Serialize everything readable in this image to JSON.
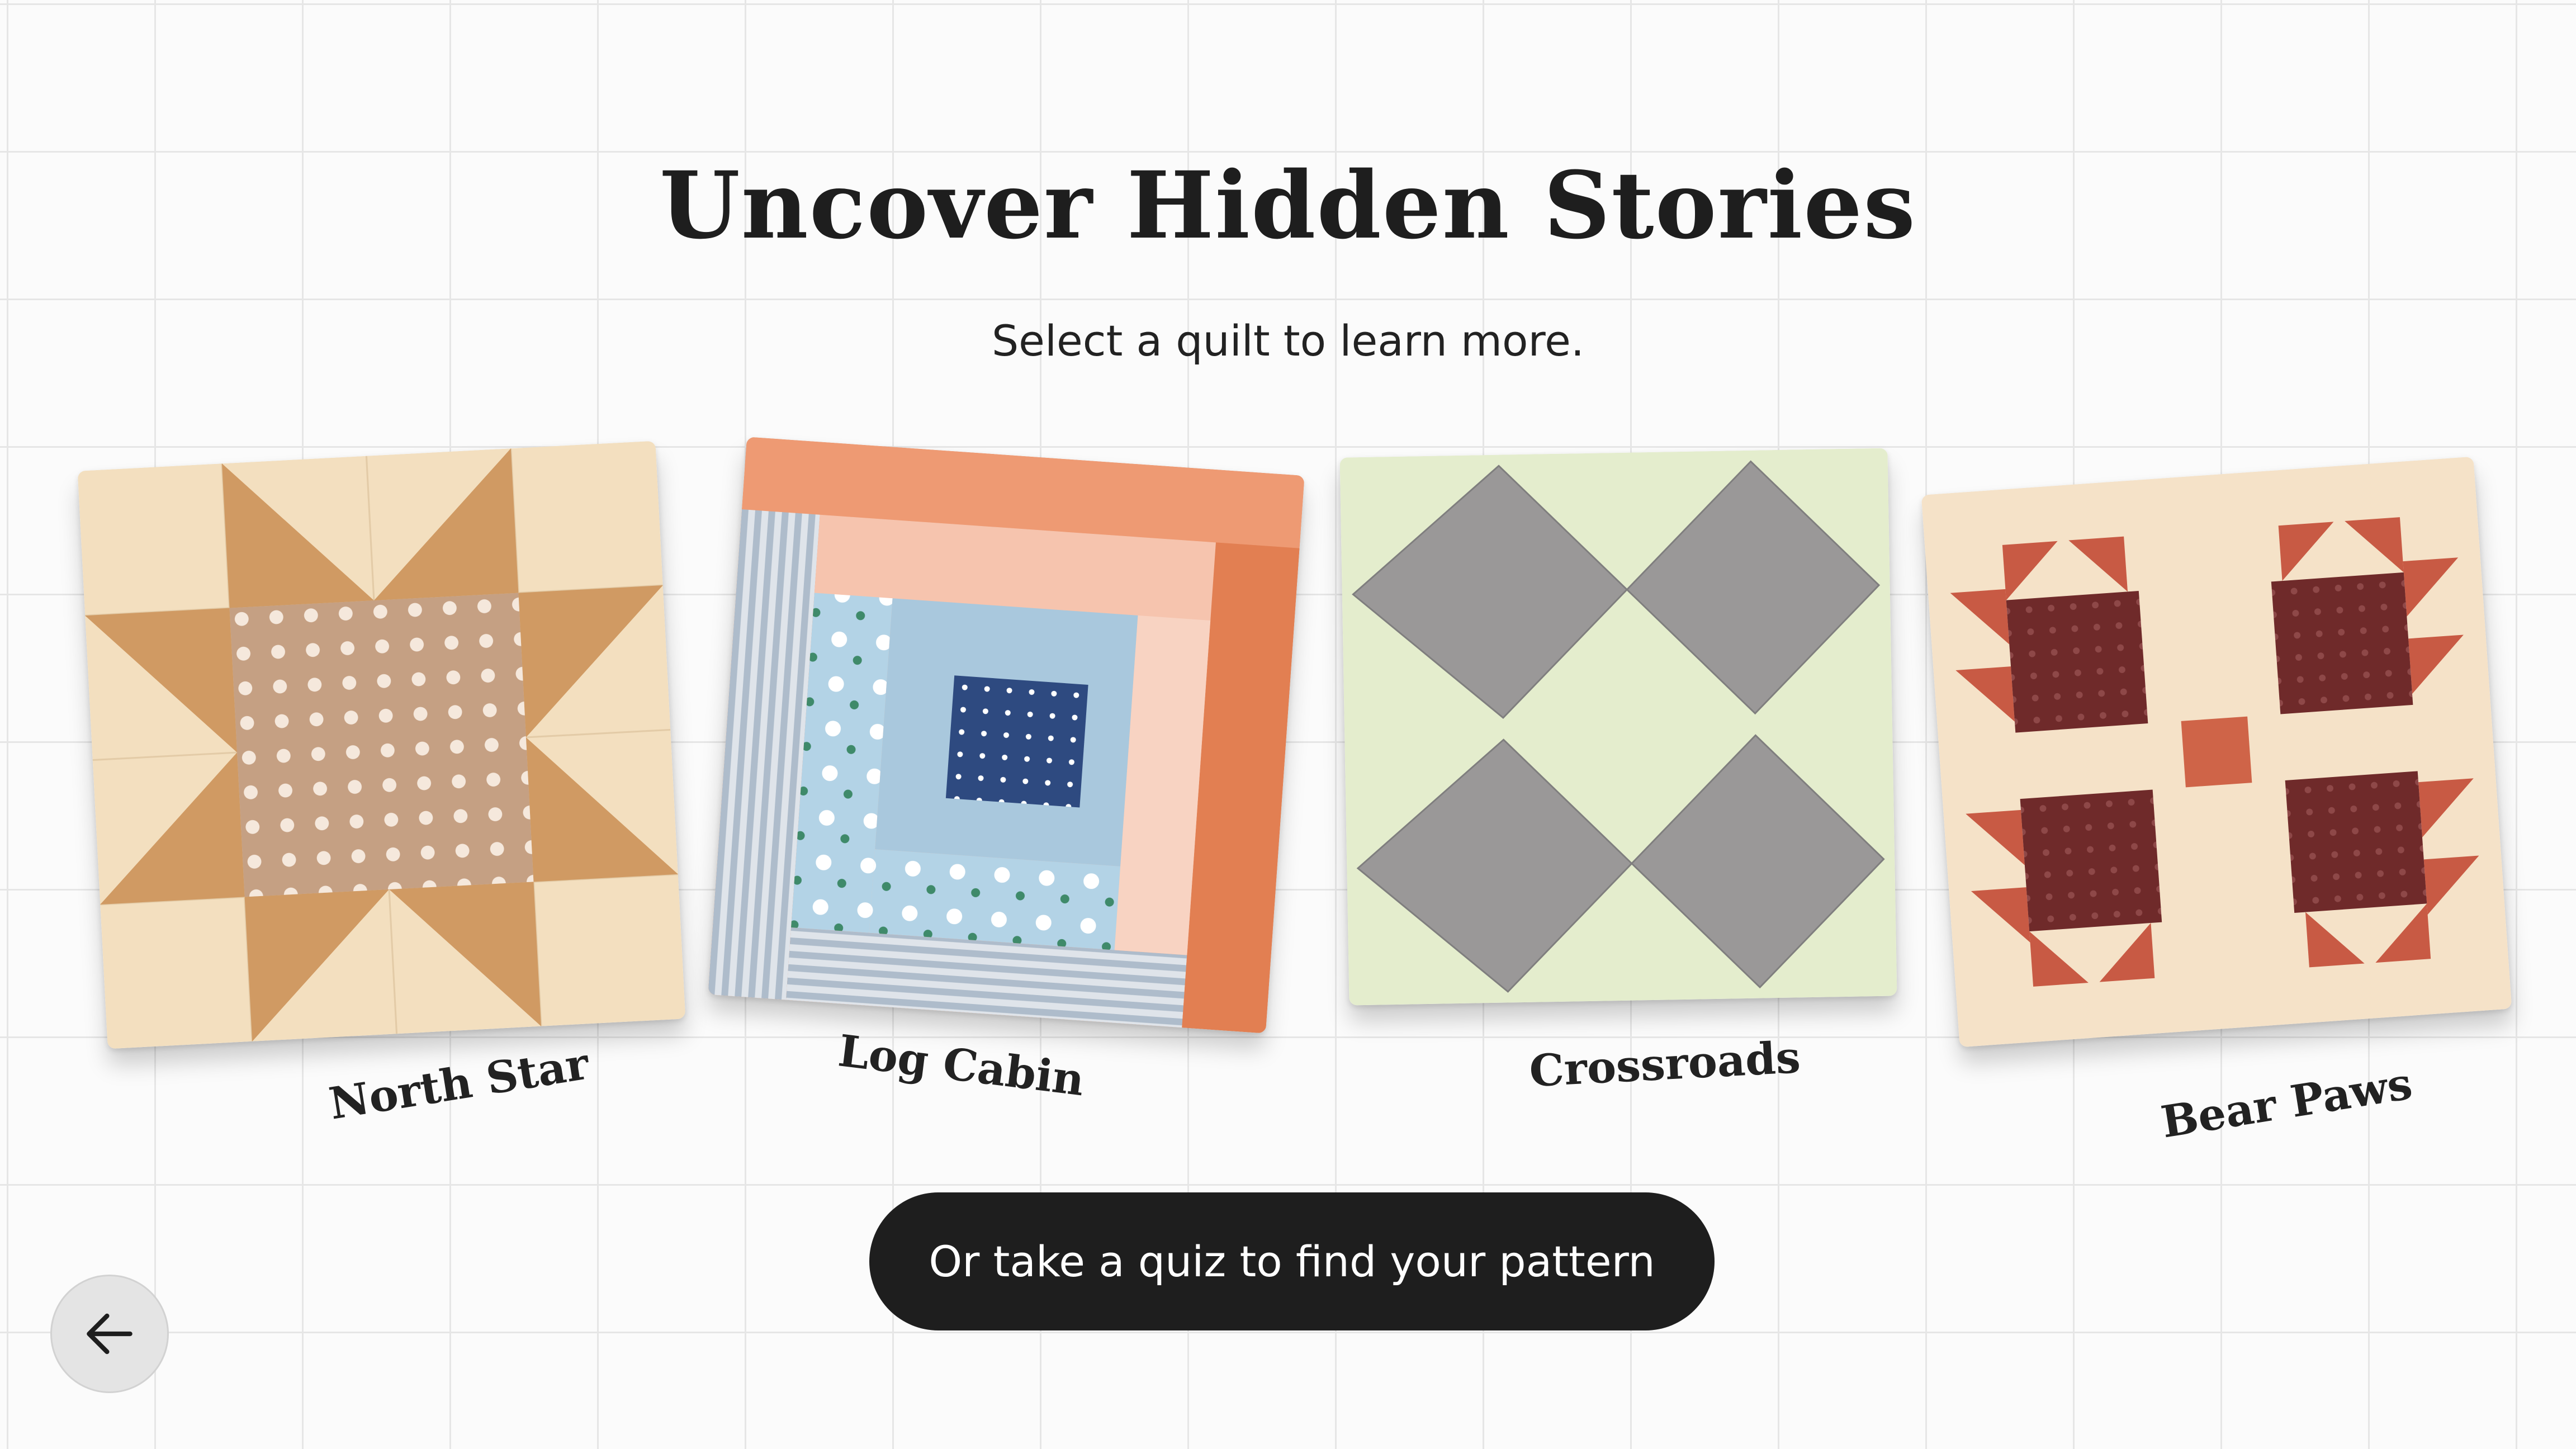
{
  "header": {
    "title": "Uncover Hidden Stories",
    "subtitle": "Select a quilt to learn more."
  },
  "quilts": [
    {
      "label": "North Star",
      "colors": {
        "background": "#f3dfbf",
        "star": "#d09a63",
        "center": "#c5a083",
        "dots": "#f5e8dc"
      }
    },
    {
      "label": "Log Cabin",
      "colors": {
        "outer": "#e98c62",
        "peach": "#f6c4ae",
        "stripe": "#c3ccd6",
        "floral": "#b3d3e6",
        "lightblue": "#a9c8dd",
        "center": "#2e4a80"
      }
    },
    {
      "label": "Crossroads",
      "colors": {
        "background": "#e4edcd",
        "diamond": "#9a9898"
      }
    },
    {
      "label": "Bear Paws",
      "colors": {
        "background": "#f5e2c8",
        "claw": "#c85a44",
        "paw": "#6f2a2a",
        "cross": "#cf6448"
      }
    }
  ],
  "actions": {
    "quiz_label": "Or take a quiz to find your pattern",
    "back_icon": "arrow-left-icon"
  }
}
